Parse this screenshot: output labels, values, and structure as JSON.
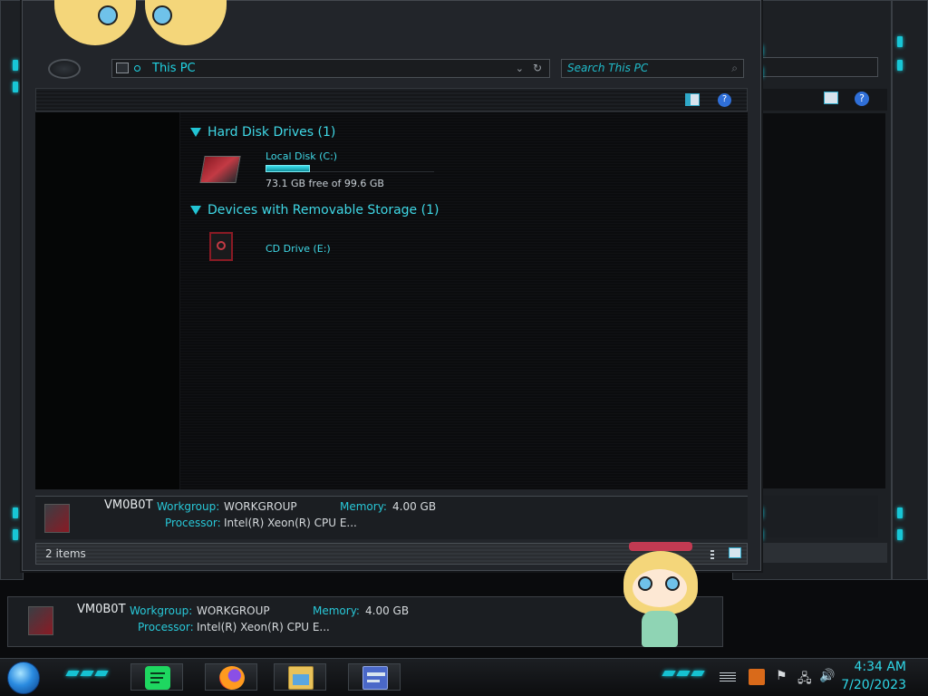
{
  "explorer": {
    "address": "This PC",
    "search_placeholder": "Search This PC",
    "groups": [
      {
        "label": "Hard Disk Drives (1)"
      },
      {
        "label": "Devices with Removable Storage (1)"
      }
    ],
    "drives": [
      {
        "name": "Local Disk (C:)",
        "free_text": "73.1 GB free of 99.6 GB",
        "used_fraction": 0.266
      },
      {
        "name": "CD Drive (E:)"
      }
    ],
    "details": {
      "computer_name": "VM0B0T",
      "workgroup_label": "Workgroup:",
      "workgroup_value": "WORKGROUP",
      "memory_label": "Memory:",
      "memory_value": "4.00 GB",
      "processor_label": "Processor:",
      "processor_value": "Intel(R) Xeon(R) CPU E..."
    },
    "status_count": "2 items"
  },
  "background_details": {
    "computer_name": "VM0B0T",
    "workgroup_label": "Workgroup:",
    "workgroup_value": "WORKGROUP",
    "memory_label": "Memory:",
    "memory_value": "4.00 GB",
    "processor_label": "Processor:",
    "processor_value": "Intel(R) Xeon(R) CPU E..."
  },
  "taskbar": {
    "apps": [
      {
        "icon": "spotify-icon"
      },
      {
        "icon": "firefox-icon"
      },
      {
        "icon": "file-explorer-icon"
      },
      {
        "icon": "control-panel-icon"
      }
    ],
    "time": "4:34 AM",
    "date": "7/20/2023"
  },
  "colors": {
    "accent": "#18c6d6",
    "window_bg": "#22252a",
    "content_bg": "#0b0c0e"
  }
}
